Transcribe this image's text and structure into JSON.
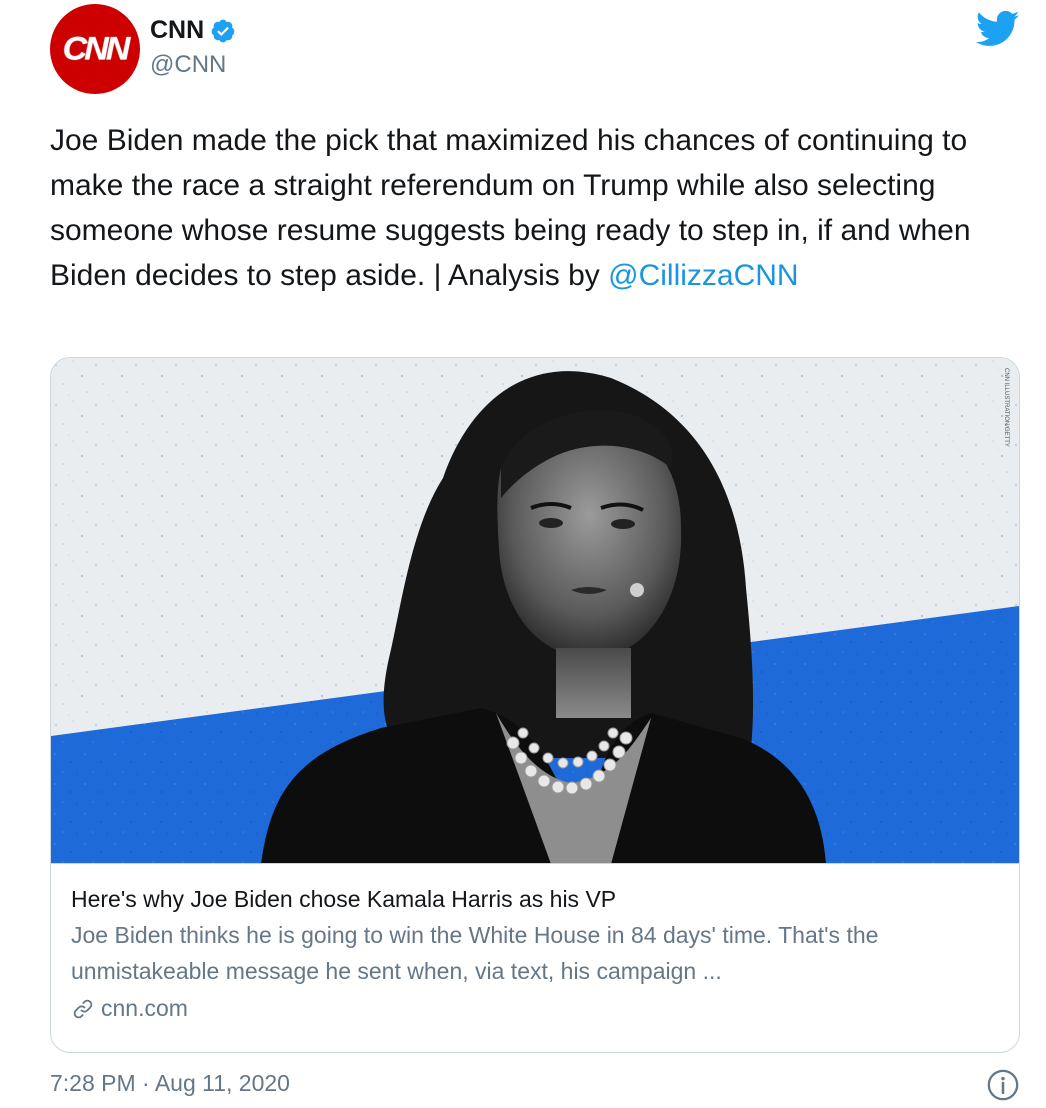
{
  "account": {
    "avatar_text": "CNN",
    "name": "CNN",
    "handle": "@CNN",
    "verified_icon": "verified-badge-icon",
    "platform_icon": "twitter-bird-icon"
  },
  "tweet": {
    "text": "Joe Biden made the pick that maximized his chances of continuing to make the race a straight referendum on Trump while also selecting someone whose resume suggests being ready to step in, if and when Biden decides to step aside. | Analysis by ",
    "mention": "@CillizzaCNN"
  },
  "card": {
    "image_caption": "CNN ILLUSTRATION/GETTY",
    "title": "Here's why Joe Biden chose Kamala Harris as his VP",
    "description": "Joe Biden thinks he is going to win the White House in 84 days' time. That's the unmistakeable message he sent when, via text, his campaign ...",
    "domain": "cnn.com"
  },
  "footer": {
    "timestamp": "7:28 PM · Aug 11, 2020",
    "info_icon": "info-icon"
  },
  "colors": {
    "twitter_blue": "#1da1f2",
    "mention_blue": "#1b95e0",
    "cnn_red": "#cc0000",
    "graphic_blue": "#1f6ad9",
    "secondary_text": "#657786"
  }
}
